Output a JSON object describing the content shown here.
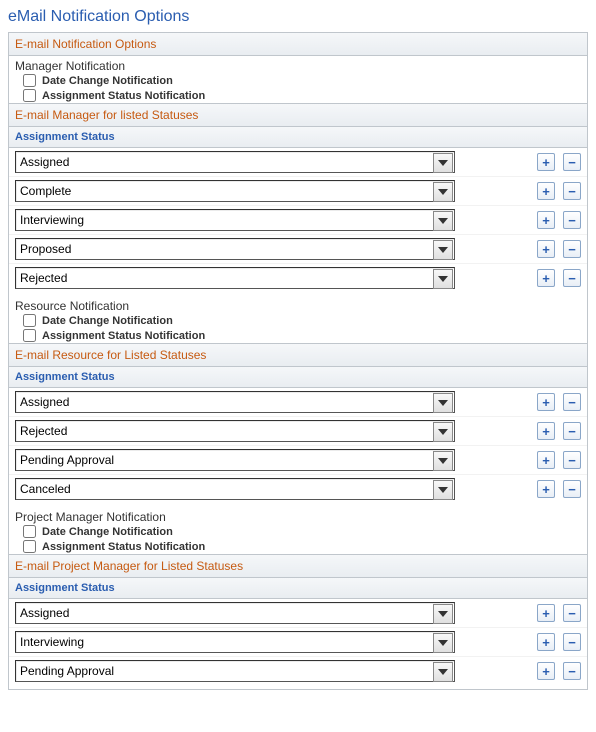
{
  "page": {
    "title": "eMail Notification Options"
  },
  "box_title": "E-mail Notification Options",
  "groups": [
    {
      "label": "Manager Notification",
      "checks": [
        {
          "label": "Date Change Notification",
          "checked": false
        },
        {
          "label": "Assignment Status Notification",
          "checked": false
        }
      ],
      "list_heading": "E-mail Manager for listed Statuses",
      "col_label": "Assignment Status",
      "rows": [
        {
          "value": "Assigned"
        },
        {
          "value": "Complete"
        },
        {
          "value": "Interviewing"
        },
        {
          "value": "Proposed"
        },
        {
          "value": "Rejected"
        }
      ]
    },
    {
      "label": "Resource Notification",
      "checks": [
        {
          "label": "Date Change Notification",
          "checked": false
        },
        {
          "label": "Assignment Status Notification",
          "checked": false
        }
      ],
      "list_heading": "E-mail Resource for Listed Statuses",
      "col_label": "Assignment Status",
      "rows": [
        {
          "value": "Assigned"
        },
        {
          "value": "Rejected"
        },
        {
          "value": "Pending Approval"
        },
        {
          "value": "Canceled"
        }
      ]
    },
    {
      "label": "Project Manager Notification",
      "checks": [
        {
          "label": "Date Change Notification",
          "checked": false
        },
        {
          "label": "Assignment Status Notification",
          "checked": false
        }
      ],
      "list_heading": "E-mail Project Manager for Listed Statuses",
      "col_label": "Assignment Status",
      "rows": [
        {
          "value": "Assigned"
        },
        {
          "value": "Interviewing"
        },
        {
          "value": "Pending Approval"
        }
      ]
    }
  ],
  "buttons": {
    "add": "+",
    "remove": "−"
  }
}
